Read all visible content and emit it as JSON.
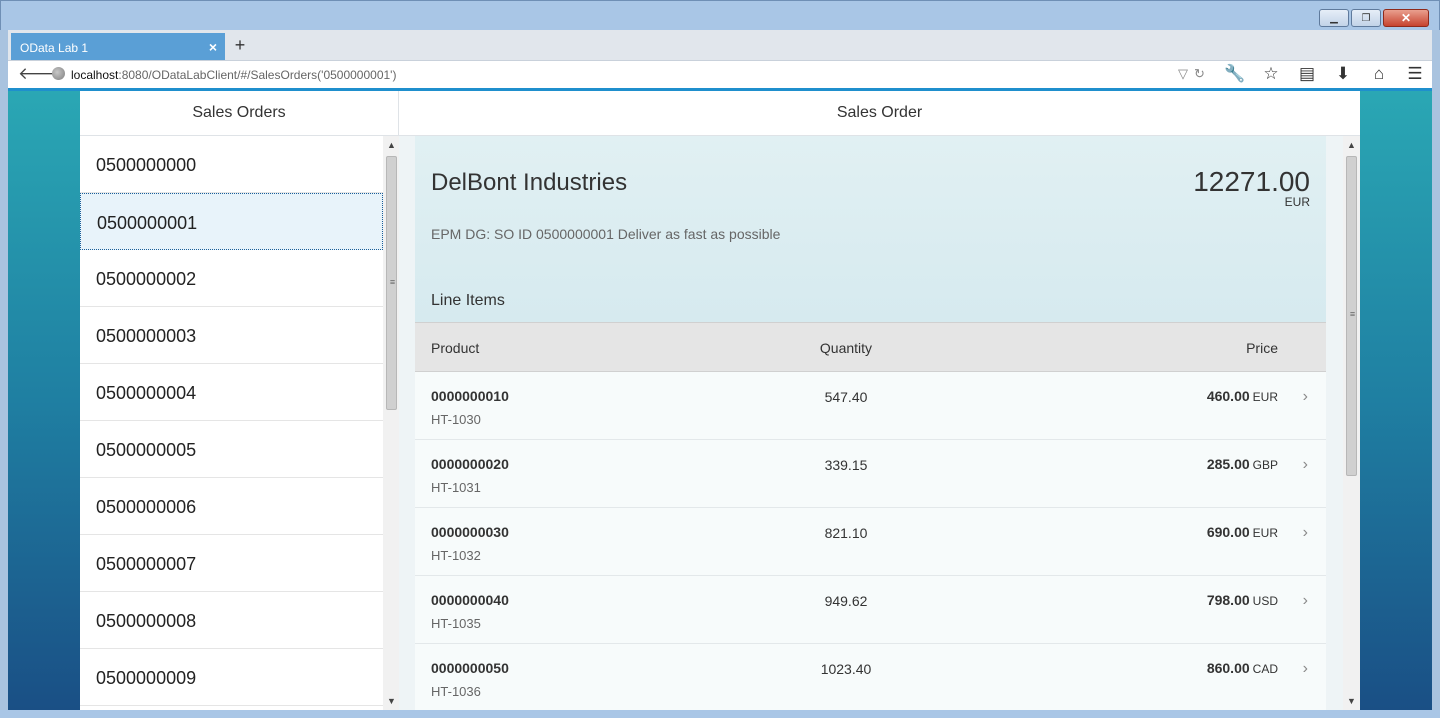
{
  "browser": {
    "tab_title": "OData Lab 1",
    "tab_close": "×",
    "new_tab": "+",
    "url_host": "localhost",
    "url_path": ":8080/ODataLabClient/#/SalesOrders('0500000001')",
    "icons": [
      "back-icon",
      "globe-icon",
      "dropdown-icon",
      "reload-icon",
      "wrench-icon",
      "star-icon",
      "reading-list-icon",
      "download-icon",
      "home-icon",
      "menu-icon"
    ]
  },
  "master": {
    "title": "Sales Orders",
    "items": [
      "0500000000",
      "0500000001",
      "0500000002",
      "0500000003",
      "0500000004",
      "0500000005",
      "0500000006",
      "0500000007",
      "0500000008",
      "0500000009"
    ],
    "selected_index": 1
  },
  "detail": {
    "title": "Sales Order",
    "company": "DelBont Industries",
    "amount": "12271.00",
    "currency": "EUR",
    "note": "EPM DG: SO ID 0500000001 Deliver as fast as possible",
    "line_items_title": "Line Items",
    "columns": {
      "product": "Product",
      "quantity": "Quantity",
      "price": "Price"
    },
    "rows": [
      {
        "id": "0000000010",
        "product": "HT-1030",
        "quantity": "547.40",
        "price": "460.00",
        "currency": "EUR"
      },
      {
        "id": "0000000020",
        "product": "HT-1031",
        "quantity": "339.15",
        "price": "285.00",
        "currency": "GBP"
      },
      {
        "id": "0000000030",
        "product": "HT-1032",
        "quantity": "821.10",
        "price": "690.00",
        "currency": "EUR"
      },
      {
        "id": "0000000040",
        "product": "HT-1035",
        "quantity": "949.62",
        "price": "798.00",
        "currency": "USD"
      },
      {
        "id": "0000000050",
        "product": "HT-1036",
        "quantity": "1023.40",
        "price": "860.00",
        "currency": "CAD"
      }
    ]
  },
  "colors": {
    "accent": "#1f8fcd",
    "selected_bg": "#e8f3fa",
    "header_bg": "#d6eaef"
  }
}
